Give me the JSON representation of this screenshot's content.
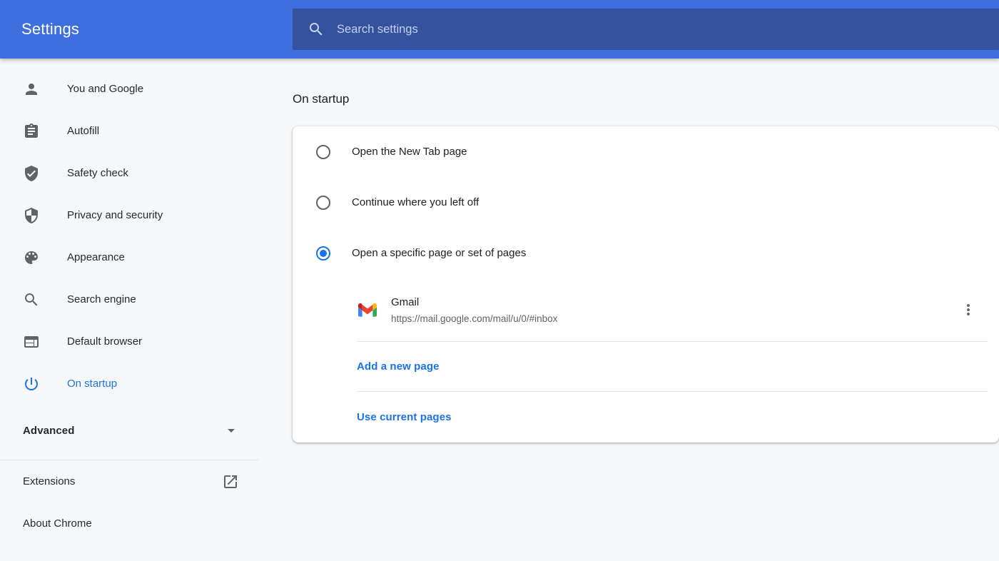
{
  "header": {
    "title": "Settings",
    "search": {
      "placeholder": "Search settings"
    }
  },
  "sidebar": {
    "items": [
      {
        "label": "You and Google",
        "icon": "person-icon",
        "selected": false
      },
      {
        "label": "Autofill",
        "icon": "clipboard-icon",
        "selected": false
      },
      {
        "label": "Safety check",
        "icon": "shield-check-icon",
        "selected": false
      },
      {
        "label": "Privacy and security",
        "icon": "shield-half-icon",
        "selected": false
      },
      {
        "label": "Appearance",
        "icon": "palette-icon",
        "selected": false
      },
      {
        "label": "Search engine",
        "icon": "search-icon",
        "selected": false
      },
      {
        "label": "Default browser",
        "icon": "browser-window-icon",
        "selected": false
      },
      {
        "label": "On startup",
        "icon": "power-icon",
        "selected": true
      }
    ],
    "advanced_label": "Advanced",
    "extensions_label": "Extensions",
    "about_label": "About Chrome"
  },
  "main": {
    "section_title": "On startup",
    "options": [
      {
        "label": "Open the New Tab page",
        "selected": false
      },
      {
        "label": "Continue where you left off",
        "selected": false
      },
      {
        "label": "Open a specific page or set of pages",
        "selected": true
      }
    ],
    "pages": [
      {
        "name": "Gmail",
        "url": "https://mail.google.com/mail/u/0/#inbox"
      }
    ],
    "add_page_label": "Add a new page",
    "use_current_label": "Use current pages"
  },
  "colors": {
    "header_bg": "#3f6edf",
    "search_field_bg": "#35529e",
    "accent_link": "#1a73e8",
    "text_primary": "#202124",
    "text_secondary": "#5f6368",
    "gmail_blue": "#4285f4",
    "gmail_green": "#34a853",
    "gmail_yellow": "#fbbc04",
    "gmail_red": "#ea4335",
    "gmail_dark_red": "#c5221f"
  }
}
